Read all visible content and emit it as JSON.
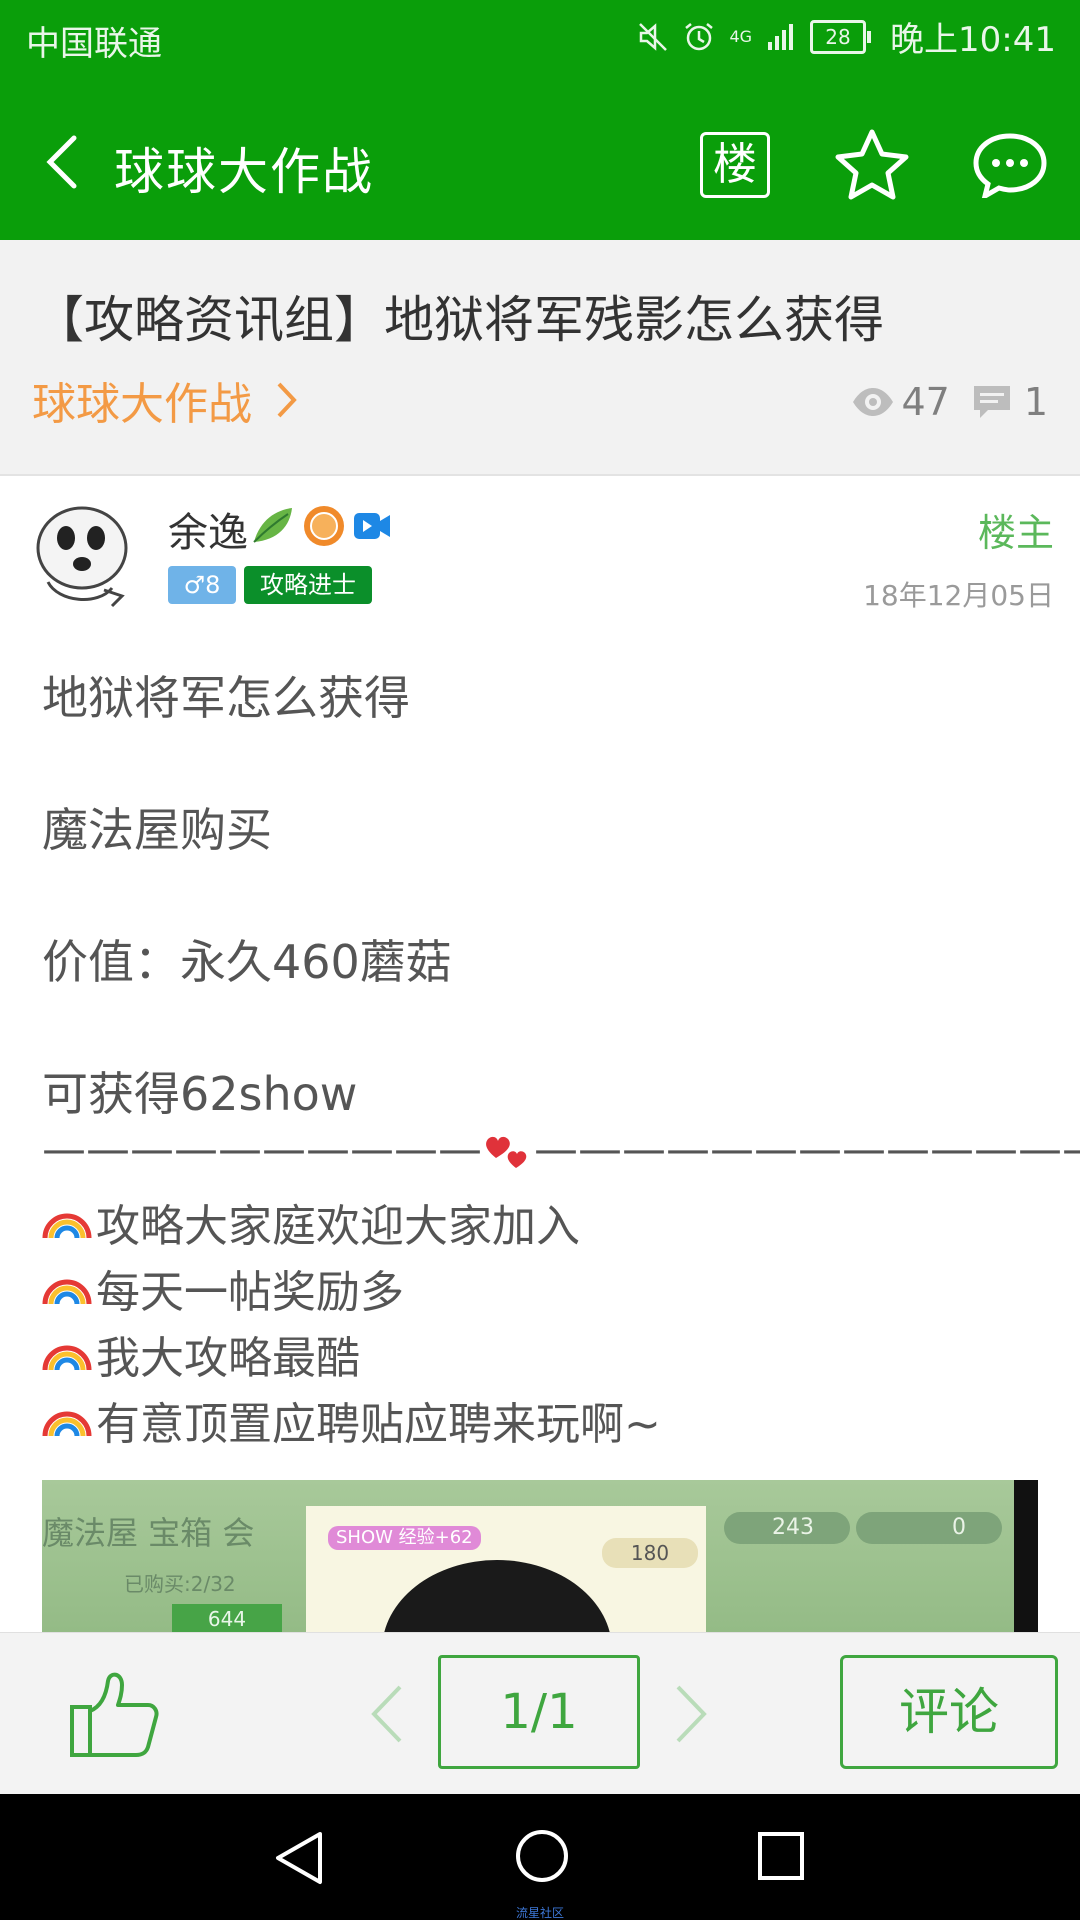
{
  "status_bar": {
    "carrier": "中国联通",
    "network": "4G",
    "battery": "28",
    "time": "晚上10:41"
  },
  "title_bar": {
    "title": "球球大作战",
    "floor_label": "楼",
    "icons": [
      "back-arrow-icon",
      "star-icon",
      "chat-bubble-icon"
    ]
  },
  "post": {
    "title": "【攻略资讯组】地狱将军残影怎么获得",
    "forum": "球球大作战",
    "views": "47",
    "comments": "1"
  },
  "author": {
    "name": "余逸",
    "gender_level": "♂8",
    "rank": "攻略进士",
    "role": "楼主",
    "date": "18年12月05日"
  },
  "content": {
    "lines": [
      "地狱将军怎么获得",
      "魔法屋购买",
      "价值：永久460蘑菇",
      "可获得62show"
    ],
    "divider_left": "——————————",
    "divider_right": "—————————————",
    "emoji_lines": [
      "攻略大家庭欢迎大家加入",
      "每天一帖奖励多",
      "我大攻略最酷",
      "有意顶置应聘贴应聘来玩啊~"
    ]
  },
  "image_texts": {
    "tabs": "魔法屋  宝箱  会",
    "show_tag": "SHOW 经验+62",
    "price": "180",
    "bought": "已购买:2/32",
    "item_price": "644",
    "currency_1": "243",
    "currency_2": "0"
  },
  "action_bar": {
    "page": "1/1",
    "comment_label": "评论"
  },
  "footer": {
    "watermark": "流星社区"
  },
  "colors": {
    "brand_green": "#0a9e0a",
    "accent_orange": "#f39a45",
    "button_green": "#3fa63f"
  }
}
